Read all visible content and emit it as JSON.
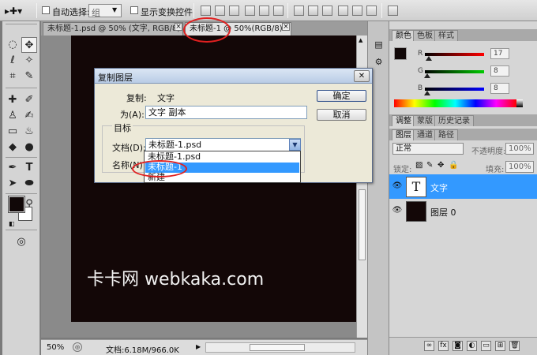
{
  "options_bar": {
    "auto_select_label": "自动选择:",
    "auto_select_value": "组",
    "show_transform_label": "显示变换控件"
  },
  "document_tabs": [
    {
      "label": "未标题-1.psd @ 50% (文字, RGB/8) *"
    },
    {
      "label": "未标题-1 @ 50%(RGB/8) *"
    }
  ],
  "canvas": {
    "watermark": "卡卡网 webkaka.com",
    "bg_color": "#130707"
  },
  "status_bar": {
    "zoom": "50%",
    "doc_info": "文档:6.18M/966.0K"
  },
  "color_panel": {
    "tabs": [
      "颜色",
      "色板",
      "样式"
    ],
    "sliders": [
      {
        "channel": "R",
        "value": "17"
      },
      {
        "channel": "G",
        "value": "8"
      },
      {
        "channel": "B",
        "value": "8"
      }
    ]
  },
  "adjust_tabs": [
    "调整",
    "蒙版",
    "历史记录"
  ],
  "layers_panel": {
    "tabs": [
      "图层",
      "通道",
      "路径"
    ],
    "blend_mode": "正常",
    "opacity_label": "不透明度:",
    "opacity_value": "100%",
    "lock_label": "锁定:",
    "fill_label": "填充:",
    "fill_value": "100%",
    "layers": [
      {
        "name": "文字",
        "thumb": "T",
        "selected": true
      },
      {
        "name": "图层 0",
        "thumb": "",
        "selected": false
      }
    ]
  },
  "dialog": {
    "title": "复制图层",
    "copy_label": "复制:",
    "copy_value": "文字",
    "as_label": "为(A):",
    "as_value": "文字 副本",
    "target_label": "目标",
    "doc_label": "文档(D):",
    "doc_value": "未标题-1.psd",
    "name_label": "名称(N):",
    "ok_label": "确定",
    "cancel_label": "取消",
    "dropdown_options": [
      "未标题-1.psd",
      "未标题-1",
      "新建"
    ],
    "dropdown_selected_index": 1
  },
  "colors": {
    "selection_blue": "#3399ff",
    "annotation_red": "#e02020",
    "foreground": "#110808"
  }
}
